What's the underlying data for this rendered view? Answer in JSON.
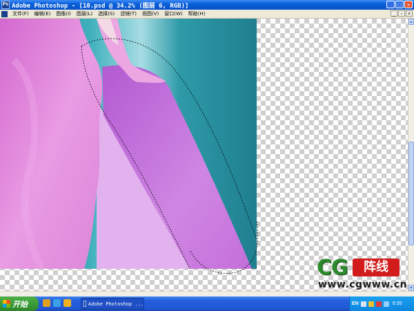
{
  "window": {
    "title": "Adobe Photoshop - [10.psd @ 34.2% (图层 6, RGB)]",
    "icon_text": "Ps",
    "minimize": "_",
    "maximize": "□",
    "close": "×"
  },
  "menu": {
    "items": [
      "文件(F)",
      "编辑(E)",
      "图像(I)",
      "图层(L)",
      "选择(S)",
      "滤镜(T)",
      "视图(V)",
      "窗口(W)",
      "帮助(H)"
    ],
    "restore": "▫",
    "minimize": "_",
    "close": "×"
  },
  "watermark": {
    "logo": "CG",
    "badge": "阵线",
    "url": "www.cgwww.cn"
  },
  "taskbar": {
    "start_label": "开始",
    "task_label": "Adobe Photoshop ...",
    "tray_lang": "EN",
    "clock": "0:35"
  },
  "colors": {
    "titlebar": "#0a5fd8",
    "fabric_pink": "#e07ad8",
    "fabric_violet": "#c577d8",
    "background_teal": "#2a9ba8",
    "selection_marquee": "#000000"
  },
  "icons": {
    "app": "photoshop-icon",
    "start": "windows-flag-icon",
    "scroll_up": "arrow-up-icon",
    "scroll_down": "arrow-down-icon"
  }
}
